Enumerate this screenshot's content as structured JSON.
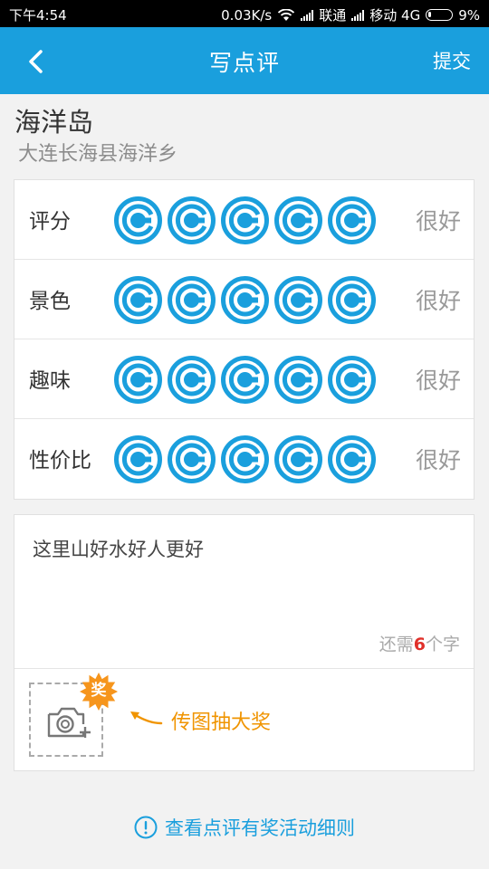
{
  "status_bar": {
    "time": "下午4:54",
    "speed": "0.03K/s",
    "carrier1": "联通",
    "carrier2": "移动 4G",
    "battery": "9%"
  },
  "header": {
    "title": "写点评",
    "submit_label": "提交"
  },
  "place": {
    "name": "海洋岛",
    "location": "大连长海县海洋乡"
  },
  "ratings": [
    {
      "label": "评分",
      "value_text": "很好",
      "score": 5,
      "max": 5
    },
    {
      "label": "景色",
      "value_text": "很好",
      "score": 5,
      "max": 5
    },
    {
      "label": "趣味",
      "value_text": "很好",
      "score": 5,
      "max": 5
    },
    {
      "label": "性价比",
      "value_text": "很好",
      "score": 5,
      "max": 5
    }
  ],
  "comment": {
    "text": "这里山好水好人更好",
    "counter_prefix": "还需",
    "counter_number": "6",
    "counter_suffix": "个字"
  },
  "photo": {
    "badge": "奖",
    "prompt": "传图抽大奖"
  },
  "rules_link": "查看点评有奖活动细则",
  "colors": {
    "accent": "#1a9fdd",
    "highlight": "#f09400",
    "counter_number": "#e0302a"
  }
}
